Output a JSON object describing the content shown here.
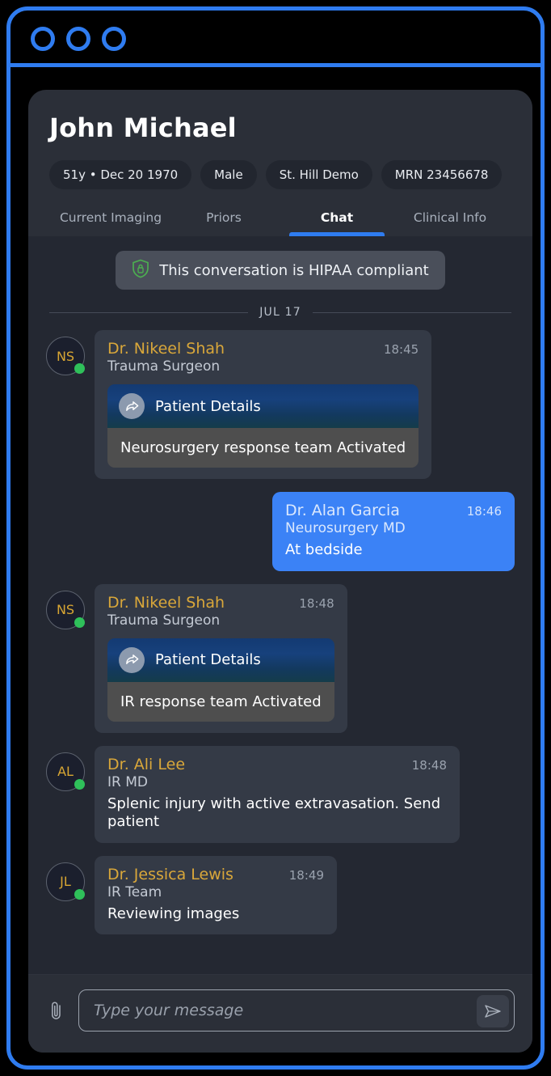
{
  "window": {
    "control_dots": [
      "window-dot-1",
      "window-dot-2",
      "window-dot-3"
    ],
    "accent_color": "#2f7cf0"
  },
  "patient": {
    "name": "John Michael",
    "chips": [
      "51y • Dec 20 1970",
      "Male",
      "St. Hill Demo",
      "MRN 23456678"
    ]
  },
  "tabs": [
    {
      "label": "Current Imaging",
      "active": false
    },
    {
      "label": "Priors",
      "active": false
    },
    {
      "label": "Chat",
      "active": true
    },
    {
      "label": "Clinical Info",
      "active": false
    }
  ],
  "chat": {
    "hipaa_banner": {
      "icon": "shield-lock-icon",
      "text": "This conversation is HIPAA compliant",
      "icon_color": "#4caf50"
    },
    "date_divider": "JUL 17",
    "messages": [
      {
        "direction": "incoming",
        "avatar_initials": "NS",
        "online": true,
        "sender": "Dr. Nikeel Shah",
        "role": "Trauma Surgeon",
        "time": "18:45",
        "attachment": {
          "icon": "share-arrow-icon",
          "label": "Patient Details",
          "body": "Neurosurgery response team Activated"
        }
      },
      {
        "direction": "outgoing",
        "sender": "Dr. Alan Garcia",
        "role": "Neurosurgery MD",
        "time": "18:46",
        "text": "At bedside"
      },
      {
        "direction": "incoming",
        "avatar_initials": "NS",
        "online": true,
        "sender": "Dr. Nikeel Shah",
        "role": "Trauma Surgeon",
        "time": "18:48",
        "attachment": {
          "icon": "share-arrow-icon",
          "label": "Patient Details",
          "body": "IR response team Activated"
        }
      },
      {
        "direction": "incoming",
        "avatar_initials": "AL",
        "online": true,
        "sender": "Dr. Ali Lee",
        "role": "IR MD",
        "time": "18:48",
        "text": "Splenic injury with active extravasation. Send patient"
      },
      {
        "direction": "incoming",
        "avatar_initials": "JL",
        "online": true,
        "sender": "Dr. Jessica Lewis",
        "role": "IR Team",
        "time": "18:49",
        "text": "Reviewing images"
      }
    ]
  },
  "composer": {
    "attach_icon": "paperclip-icon",
    "input_value": "",
    "input_placeholder": "Type your message",
    "send_icon": "send-paper-plane-icon"
  }
}
